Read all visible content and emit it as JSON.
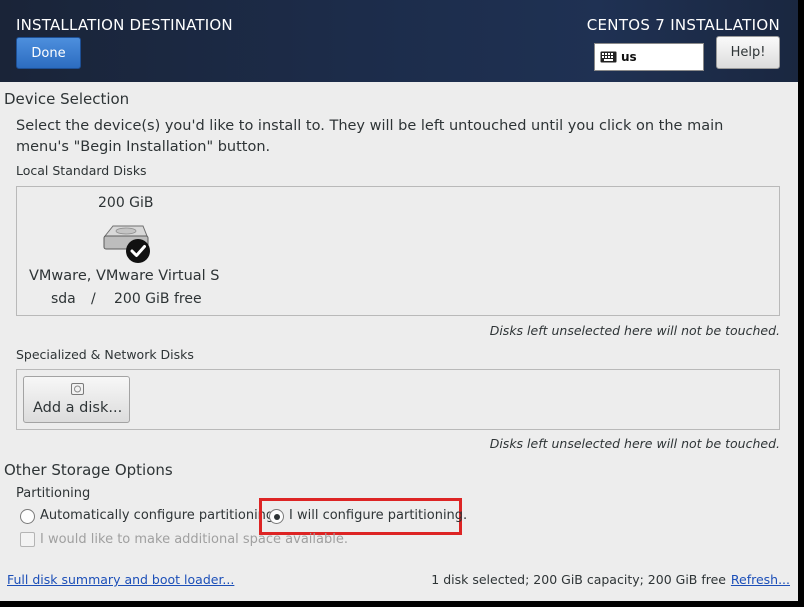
{
  "header": {
    "title": "INSTALLATION DESTINATION",
    "product": "CENTOS 7 INSTALLATION",
    "done_label": "Done",
    "keyboard_layout": "us",
    "help_label": "Help!"
  },
  "device_selection": {
    "heading": "Device Selection",
    "intro": "Select the device(s) you'd like to install to.  They will be left untouched until you click on the main menu's \"Begin Installation\" button.",
    "local_heading": "Local Standard Disks",
    "disks": [
      {
        "size": "200 GiB",
        "name": "VMware, VMware Virtual S",
        "device": "sda",
        "separator": "/",
        "free": "200 GiB free",
        "selected": true
      }
    ],
    "local_note": "Disks left unselected here will not be touched.",
    "specialized_heading": "Specialized & Network Disks",
    "add_disk_label": "Add a disk...",
    "specialized_note": "Disks left unselected here will not be touched."
  },
  "other_storage": {
    "heading": "Other Storage Options",
    "partitioning_heading": "Partitioning",
    "auto_label": "Automatically configure partitioning.",
    "manual_label": "I will configure partitioning.",
    "selected_option": "manual",
    "space_label": "I would like to make additional space available."
  },
  "footer": {
    "summary_link": "Full disk summary and boot loader...",
    "status": "1 disk selected; 200 GiB capacity; 200 GiB free",
    "refresh_link": "Refresh..."
  },
  "colors": {
    "header_bg": "#1c2c4a",
    "done_button": "#2c6cc0",
    "highlight": "#dd2424",
    "link": "#1c4fb8"
  }
}
